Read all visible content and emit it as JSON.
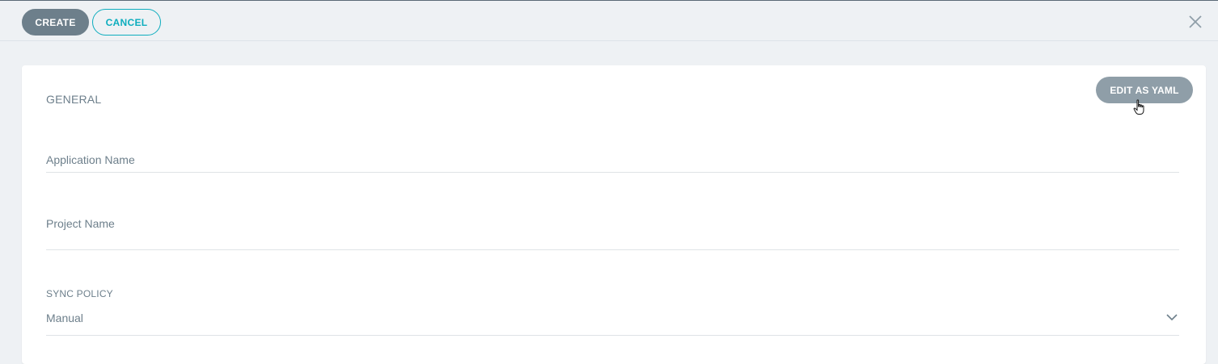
{
  "toolbar": {
    "create_label": "CREATE",
    "cancel_label": "CANCEL",
    "close_icon": "close-icon"
  },
  "form": {
    "section_title": "GENERAL",
    "edit_yaml_label": "EDIT AS YAML",
    "application_name": {
      "label": "Application Name",
      "value": ""
    },
    "project_name": {
      "label": "Project Name",
      "value": ""
    },
    "sync_policy": {
      "caption": "SYNC POLICY",
      "selected": "Manual",
      "icon": "chevron-down-icon"
    }
  },
  "colors": {
    "primary_button": "#6d7f8b",
    "accent": "#0dadbe",
    "yaml_button": "#8f9ea8",
    "background": "#eef1f4"
  }
}
